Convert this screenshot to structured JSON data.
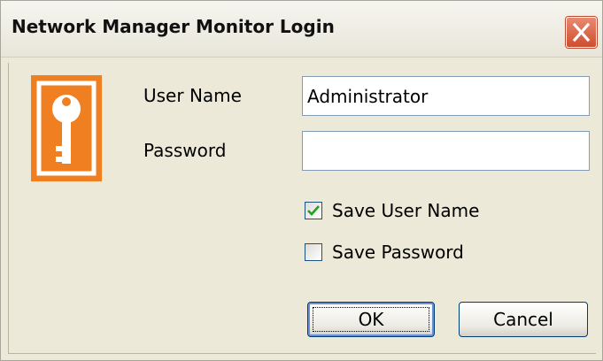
{
  "window": {
    "title": "Network Manager Monitor Login",
    "close_icon": "close-icon"
  },
  "icon": {
    "name": "key-icon",
    "color": "#f07f22"
  },
  "form": {
    "username_label": "User Name",
    "username_value": "Administrator",
    "password_label": "Password",
    "password_value": ""
  },
  "options": {
    "save_username_label": "Save User Name",
    "save_username_checked": true,
    "save_password_label": "Save Password",
    "save_password_checked": false
  },
  "buttons": {
    "ok_label": "OK",
    "cancel_label": "Cancel"
  }
}
